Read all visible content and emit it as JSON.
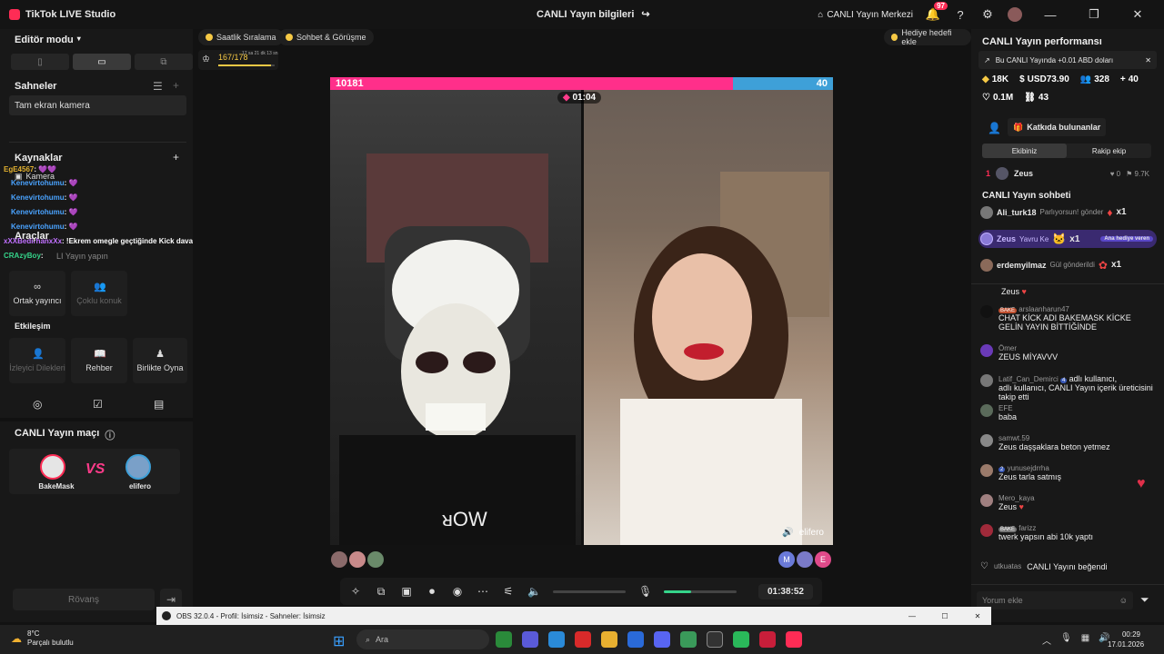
{
  "titlebar": {
    "app_name": "TikTok LIVE Studio",
    "center_title": "CANLI Yayın bilgileri",
    "live_center": "CANLI Yayın Merkezi",
    "notif_count": "97"
  },
  "left": {
    "editor_mode": "Editör modu",
    "scenes_title": "Sahneler",
    "scene_item": "Tam ekran kamera",
    "sources_title": "Kaynaklar",
    "source_camera": "Kamera",
    "tools_title": "Araçlar",
    "go_live_hint": "LI Yayın yapın",
    "tools": [
      {
        "label": "Ortak yayıncı",
        "enabled": true
      },
      {
        "label": "Çoklu konuk",
        "enabled": false
      }
    ],
    "interaction_title": "Etkileşim",
    "interaction": [
      {
        "label": "İzleyici Dilekleri",
        "enabled": false
      },
      {
        "label": "Rehber",
        "enabled": true
      },
      {
        "label": "Birlikte Oyna",
        "enabled": true
      }
    ],
    "match_title": "CANLI Yayın maçı",
    "player1": "BakeMask",
    "vs": "VS",
    "player2": "elifero",
    "rematch": "Rövanş",
    "chat_overlay": [
      {
        "name": "EgE4567",
        "text": ":"
      },
      {
        "name": "Kenevirtohumu",
        "text": ":"
      },
      {
        "name": "Kenevirtohumu",
        "text": ":"
      },
      {
        "name": "Kenevirtohumu",
        "text": ":"
      },
      {
        "name": "Kenevirtohumu",
        "text": ":"
      },
      {
        "name": "xXXBedirhanxXx",
        "text": ": !Ekrem omegle geçtiğinde Kick davam edicekmi"
      },
      {
        "name": "CRAzyBoy",
        "text": ":"
      }
    ]
  },
  "center": {
    "pill_hourly": "Saatlik Sıralama",
    "pill_chat": "Sohbet & Görüşme",
    "goal_button": "Hediye hedefi ekle",
    "progress": "167/178",
    "progress_fraction": 0.94,
    "progress_sub": "17 sa 21 dk 13 sn",
    "score_left": "10181",
    "score_right": "40",
    "battle_timer": "01:04",
    "right_cam_name": "elifero",
    "guest_initial": "M",
    "guest_initial2": "E",
    "stream_time": "01:38:52",
    "mic_level": 0.38
  },
  "right": {
    "perf_title": "CANLI Yayın performansı",
    "banner": "Bu CANLI Yayında +0.01 ABD doları",
    "stats": {
      "diamonds": "18K",
      "usd": "USD73.90",
      "viewers": "328",
      "new_followers": "40",
      "likes": "0.1M",
      "shares": "43"
    },
    "contributors_button": "Katkıda bulunanlar",
    "tab_team": "Ekibiniz",
    "tab_rival": "Rakip ekip",
    "rank_num": "1",
    "rank_name": "Zeus",
    "rank_heart": "0",
    "rank_score": "9.7K",
    "chat_title": "CANLI Yayın sohbeti",
    "gifts": [
      {
        "name": "Ali_turk18",
        "text": "Parlıyorsun! gönder",
        "count": "x1"
      },
      {
        "name": "Zeus",
        "text": "Yavru Ke",
        "count": "x1",
        "tag": "Ana hediye veren"
      },
      {
        "name": "erdemyilmaz",
        "text": "Gül gönderildi",
        "count": "x1"
      }
    ],
    "messages": [
      {
        "name": "",
        "text": "Zeus"
      },
      {
        "name": "arslaanharun47",
        "badge": "BAKE",
        "text": "CHAT KİCK ADI BAKEMASK KİCKE GELİN YAYIN BİTTİĞİNDE"
      },
      {
        "name": "Ömer",
        "text": "ZEUS MİYAVVV"
      },
      {
        "name": "Latif_Can_Demirci",
        "badge": "4",
        "text": "adlı kullanıcı, CANLI Yayın içerik üreticisini takip etti"
      },
      {
        "name": "EFE",
        "text": "baba"
      },
      {
        "name": "samwt.59",
        "text": "Zeus daşşaklara beton yetmez"
      },
      {
        "name": "yunusejdrrha",
        "badge": "2",
        "text": "Zeus tarla satmış"
      },
      {
        "name": "Mero_kaya",
        "text": "Zeus"
      },
      {
        "name": "farizz",
        "badge": "BAKE",
        "text": "twerk yapsın abi 10k yaptı"
      },
      {
        "name": "utkuatas",
        "text": "CANLI Yayını beğendi"
      }
    ],
    "comment_placeholder": "Yorum ekle"
  },
  "obs": {
    "title": "OBS 32.0.4 - Profil: İsimsiz - Sahneler: İsimsiz"
  },
  "taskbar": {
    "weather_temp": "8°C",
    "weather_desc": "Parçalı bulutlu",
    "search": "Ara",
    "time": "00:29",
    "date": "17.01.2026"
  }
}
